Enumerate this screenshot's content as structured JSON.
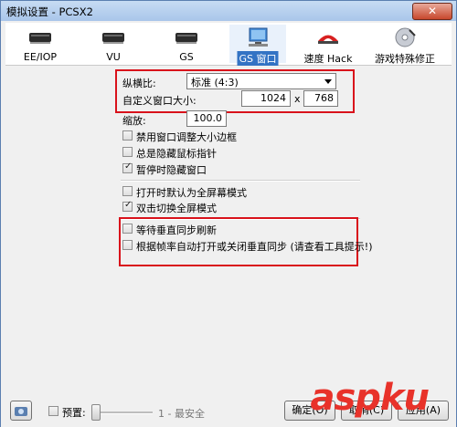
{
  "window": {
    "title": "模拟设置 - PCSX2",
    "close_label": "✕"
  },
  "tabs": [
    {
      "label": "EE/IOP",
      "icon": "chip-icon"
    },
    {
      "label": "VU",
      "icon": "chip-icon"
    },
    {
      "label": "GS",
      "icon": "chip-icon"
    },
    {
      "label": "GS 窗口",
      "icon": "monitor-icon",
      "active": true
    },
    {
      "label": "速度 Hack",
      "icon": "speed-hack-icon"
    },
    {
      "label": "游戏特殊修正",
      "icon": "disc-icon"
    }
  ],
  "gs_window": {
    "aspect_label": "纵横比:",
    "aspect_value": "标准 (4:3)",
    "custom_size_label": "自定义窗口大小:",
    "width_value": "1024",
    "size_sep": "x",
    "height_value": "768",
    "zoom_label": "缩放:",
    "zoom_value": "100.0",
    "options": [
      {
        "label": "禁用窗口调整大小边框",
        "checked": false
      },
      {
        "label": "总是隐藏鼠标指针",
        "checked": false
      },
      {
        "label": "暂停时隐藏窗口",
        "checked": true
      }
    ],
    "fullscreen_options": [
      {
        "label": "打开时默认为全屏幕模式",
        "checked": false
      },
      {
        "label": "双击切换全屏模式",
        "checked": true
      }
    ],
    "vsync_options": [
      {
        "label": "等待垂直同步刷新",
        "checked": false
      },
      {
        "label": "根据帧率自动打开或关闭垂直同步 (请查看工具提示!)",
        "checked": false
      }
    ]
  },
  "footer": {
    "preset_label": "预置:",
    "preset_checked": false,
    "preset_level": "1 - 最安全",
    "ok_label": "确定(O)",
    "cancel_label": "取消(C)",
    "apply_label": "应用(A)"
  },
  "watermark": {
    "text": "aspku"
  },
  "colors": {
    "highlight": "#d9121b",
    "active_tab": "#3373c4"
  }
}
